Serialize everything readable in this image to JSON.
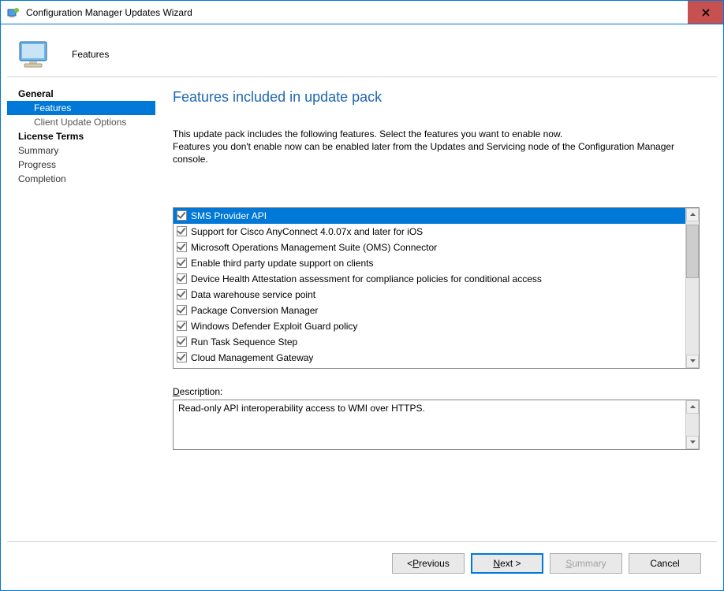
{
  "window": {
    "title": "Configuration Manager Updates Wizard",
    "close_label": "X"
  },
  "header": {
    "label": "Features"
  },
  "sidebar": {
    "items": [
      {
        "label": "General",
        "type": "section"
      },
      {
        "label": "Features",
        "type": "sub",
        "selected": true
      },
      {
        "label": "Client Update Options",
        "type": "sub"
      },
      {
        "label": "License Terms",
        "type": "section"
      },
      {
        "label": "Summary",
        "type": "item"
      },
      {
        "label": "Progress",
        "type": "item"
      },
      {
        "label": "Completion",
        "type": "item"
      }
    ]
  },
  "content": {
    "title": "Features included in update pack",
    "intro_line1": "This update pack includes the following features. Select the features you want to enable now.",
    "intro_line2": "Features you don't enable now can be enabled later from the Updates and Servicing node of the Configuration Manager console.",
    "features": [
      {
        "label": "SMS Provider API",
        "checked": true,
        "selected": true
      },
      {
        "label": "Support for Cisco AnyConnect 4.0.07x and later for iOS",
        "checked": true
      },
      {
        "label": "Microsoft Operations Management Suite (OMS) Connector",
        "checked": true
      },
      {
        "label": "Enable third party update support on clients",
        "checked": true
      },
      {
        "label": "Device Health Attestation assessment for compliance policies for conditional access",
        "checked": true
      },
      {
        "label": "Data warehouse service point",
        "checked": true
      },
      {
        "label": "Package Conversion Manager",
        "checked": true
      },
      {
        "label": "Windows Defender Exploit Guard policy",
        "checked": true
      },
      {
        "label": "Run Task Sequence Step",
        "checked": true
      },
      {
        "label": "Cloud Management Gateway",
        "checked": true
      }
    ],
    "description_label": "Description:",
    "description_text": "Read-only API interoperability access to WMI over HTTPS."
  },
  "footer": {
    "previous": "< Previous",
    "next": "Next >",
    "summary": "Summary",
    "cancel": "Cancel"
  }
}
